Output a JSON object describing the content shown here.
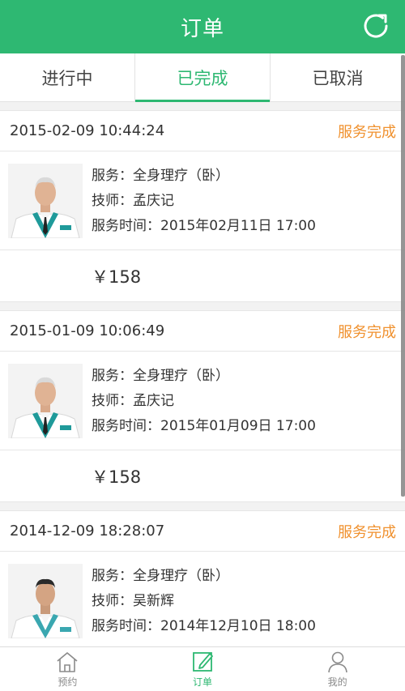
{
  "header": {
    "title": "订单",
    "refresh_icon": "refresh-icon"
  },
  "tabs": [
    {
      "label": "进行中",
      "active": false
    },
    {
      "label": "已完成",
      "active": true
    },
    {
      "label": "已取消",
      "active": false
    }
  ],
  "orders": [
    {
      "datetime": "2015-02-09 10:44:24",
      "status": "服务完成",
      "service": "服务：全身理疗（卧）",
      "technician": "技师：孟庆记",
      "service_time": "服务时间：2015年02月11日  17:00",
      "price": "￥158"
    },
    {
      "datetime": "2015-01-09 10:06:49",
      "status": "服务完成",
      "service": "服务：全身理疗（卧）",
      "technician": "技师：孟庆记",
      "service_time": "服务时间：2015年01月09日  17:00",
      "price": "￥158"
    },
    {
      "datetime": "2014-12-09 18:28:07",
      "status": "服务完成",
      "service": "服务：全身理疗（卧）",
      "technician": "技师：吴新辉",
      "service_time": "服务时间：2014年12月10日  18:00",
      "price": ""
    }
  ],
  "bottom_nav": [
    {
      "label": "预约",
      "icon": "home-icon",
      "active": false
    },
    {
      "label": "订单",
      "icon": "edit-icon",
      "active": true
    },
    {
      "label": "我的",
      "icon": "user-icon",
      "active": false
    }
  ],
  "colors": {
    "brand": "#2eb872",
    "status": "#f0912e"
  }
}
